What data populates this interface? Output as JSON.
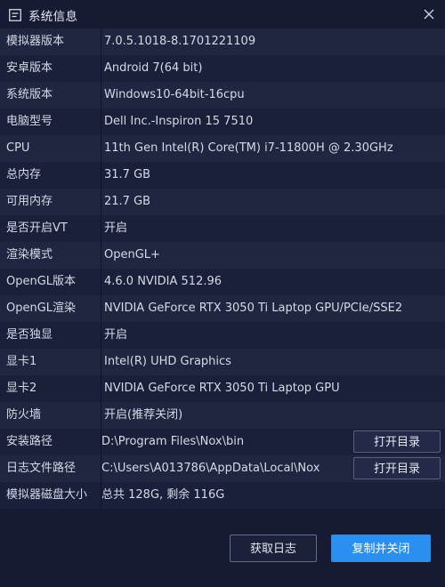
{
  "window": {
    "title": "系统信息",
    "accent_color": "#2b8ff0",
    "icons": {
      "title": "window-icon",
      "close": "close-icon"
    }
  },
  "rows": [
    {
      "key": "模拟器版本",
      "value": "7.0.5.1018-8.1701221109"
    },
    {
      "key": "安卓版本",
      "value": "Android 7(64 bit)"
    },
    {
      "key": "系统版本",
      "value": "Windows10-64bit-16cpu"
    },
    {
      "key": "电脑型号",
      "value": "Dell Inc.-Inspiron 15 7510"
    },
    {
      "key": "CPU",
      "value": "11th Gen Intel(R) Core(TM) i7-11800H @ 2.30GHz"
    },
    {
      "key": "总内存",
      "value": "31.7 GB"
    },
    {
      "key": "可用内存",
      "value": "21.7 GB"
    },
    {
      "key": "是否开启VT",
      "value": "开启"
    },
    {
      "key": "渲染模式",
      "value": "OpenGL+"
    },
    {
      "key": "OpenGL版本",
      "value": "4.6.0 NVIDIA 512.96"
    },
    {
      "key": "OpenGL渲染",
      "value": "NVIDIA GeForce RTX 3050 Ti Laptop GPU/PCIe/SSE2"
    },
    {
      "key": "是否独显",
      "value": "开启"
    },
    {
      "key": "显卡1",
      "value": "Intel(R) UHD Graphics"
    },
    {
      "key": "显卡2",
      "value": "NVIDIA GeForce RTX 3050 Ti Laptop GPU"
    },
    {
      "key": "防火墙",
      "value": "开启(推荐关闭)"
    },
    {
      "key": "安装路径",
      "value": "D:\\Program Files\\Nox\\bin",
      "button": "打开目录"
    },
    {
      "key": "日志文件路径",
      "value": "C:\\Users\\A013786\\AppData\\Local\\Nox",
      "button": "打开目录"
    },
    {
      "key": "模拟器磁盘大小",
      "value": "总共 128G, 剩余 116G"
    }
  ],
  "footer": {
    "get_log_label": "获取日志",
    "copy_close_label": "复制并关闭"
  }
}
